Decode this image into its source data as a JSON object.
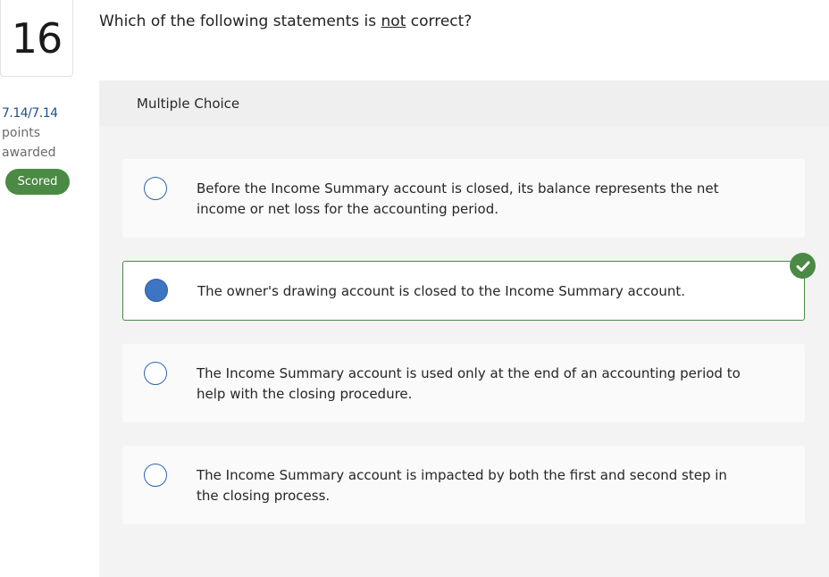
{
  "question": {
    "number": "16",
    "prompt_before": "Which of the following statements is ",
    "prompt_emphasis": "not",
    "prompt_after": " correct?"
  },
  "score": {
    "points": "7.14/7.14",
    "points_label": "points",
    "awarded_label": "awarded",
    "badge": "Scored"
  },
  "panel": {
    "header": "Multiple Choice"
  },
  "options": [
    {
      "text": "Before the Income Summary account is closed, its balance represents the net income or net loss for the accounting period.",
      "selected": false
    },
    {
      "text": "The owner's drawing account is closed to the Income Summary account.",
      "selected": true,
      "correct": true
    },
    {
      "text": "The Income Summary account is used only at the end of an accounting period to help with the closing procedure.",
      "selected": false
    },
    {
      "text": "The Income Summary account is impacted by both the first and second step in the closing process.",
      "selected": false
    }
  ],
  "colors": {
    "accent_green": "#4a8a44",
    "radio_blue": "#3d74c4",
    "points_blue": "#1e4f8c"
  },
  "icons": {
    "correct": "check-circle-icon"
  }
}
